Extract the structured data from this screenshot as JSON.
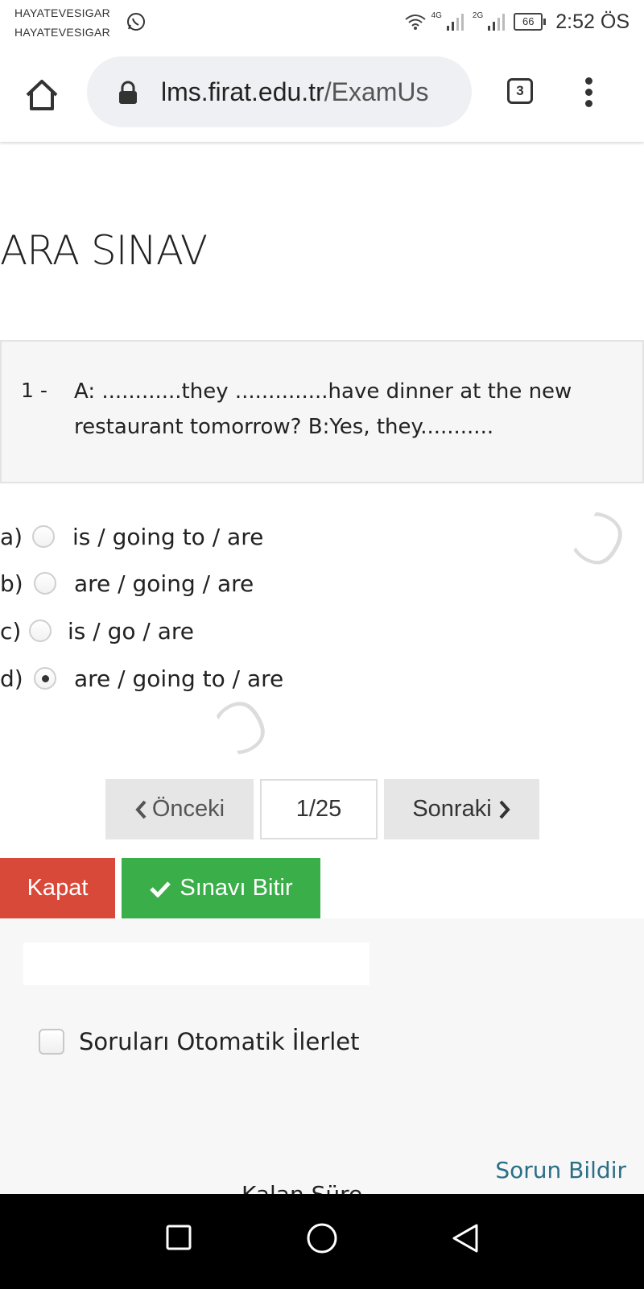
{
  "status_bar": {
    "carrier_line1": "HAYATEVESIGAR",
    "carrier_line2": "HAYATEVESIGAR",
    "net1": "4G",
    "net2": "2G",
    "battery": "66",
    "time": "2:52 ÖS"
  },
  "browser": {
    "url_domain": "lms.firat.edu.tr",
    "url_path": "/ExamUs",
    "tab_count": "3"
  },
  "page": {
    "title": "ARA SINAV",
    "question": {
      "number": "1 -",
      "text": "A: ............they ..............have dinner at the new restaurant tomorrow? B:Yes, they..........."
    },
    "options": [
      {
        "letter": "a)",
        "text": "is / going to / are",
        "selected": false
      },
      {
        "letter": "b)",
        "text": "are / going / are",
        "selected": false
      },
      {
        "letter": "c)",
        "text": "is / go / are",
        "selected": false
      },
      {
        "letter": "d)",
        "text": "are / going to / are",
        "selected": true
      }
    ],
    "pager": {
      "prev_label": "Önceki",
      "position": "1/25",
      "next_label": "Sonraki"
    },
    "close_label": "Kapat",
    "finish_label": "Sınavı Bitir",
    "auto_advance_label": "Soruları Otomatik İlerlet",
    "report_label": "Sorun Bildir",
    "partial_text": "Kalan Süre"
  },
  "colors": {
    "close_button": "#d9493a",
    "finish_button": "#3aae48",
    "report_link": "#2a6f86"
  }
}
